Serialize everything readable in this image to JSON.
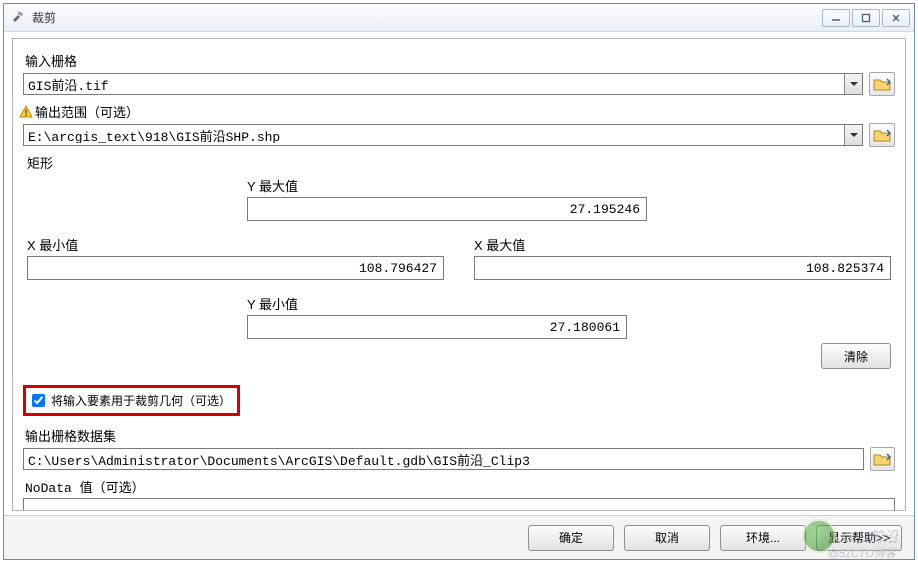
{
  "window": {
    "title": "裁剪"
  },
  "labels": {
    "input_raster": "输入栅格",
    "output_extent": "输出范围（可选）",
    "rectangle": "矩形",
    "y_max": "Y 最大值",
    "y_min": "Y 最小值",
    "x_min": "X 最小值",
    "x_max": "X 最大值",
    "clear": "清除",
    "use_features": "将输入要素用于裁剪几何（可选）",
    "output_raster": "输出栅格数据集",
    "nodata": "NoData 值（可选）"
  },
  "values": {
    "input_raster": "GIS前沿.tif",
    "output_extent": "E:\\arcgis_text\\918\\GIS前沿SHP.shp",
    "y_max": "27.195246",
    "y_min": "27.180061",
    "x_min": "108.796427",
    "x_max": "108.825374",
    "use_features_checked": true,
    "output_raster": "C:\\Users\\Administrator\\Documents\\ArcGIS\\Default.gdb\\GIS前沿_Clip3",
    "nodata": ""
  },
  "buttons": {
    "ok": "确定",
    "cancel": "取消",
    "env": "环境...",
    "show_help": "显示帮助>>"
  },
  "watermark": {
    "text": "GIS前沿",
    "sub": "@51CTO博客"
  }
}
